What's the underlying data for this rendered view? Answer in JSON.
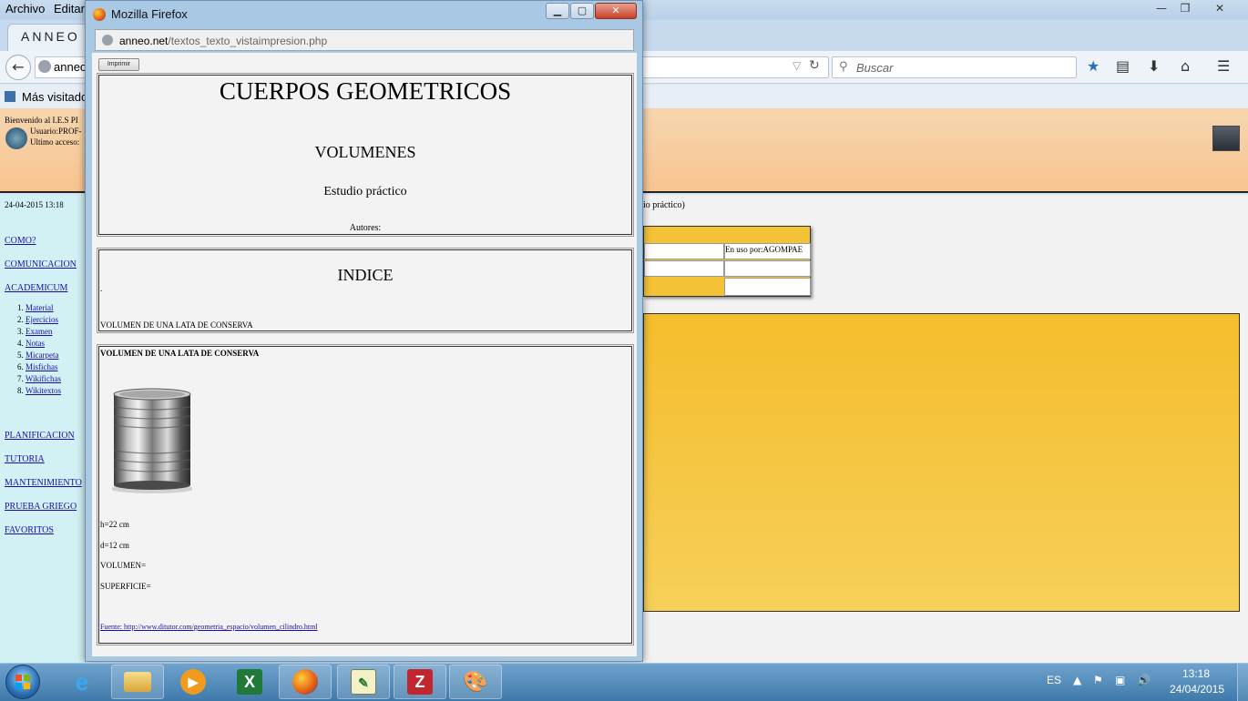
{
  "background_window": {
    "menu": [
      "Archivo",
      "Editar"
    ],
    "tab_title": "ANNEO",
    "url_text": "anneo",
    "search_placeholder": "Buscar",
    "bookmarks_label": "Más visitados",
    "page": {
      "welcome": "Bienvenido al I.E.S PI",
      "user": "Usuario:PROF-",
      "last_access": "Ultimo acceso:",
      "date": "24-04-2015 13:18",
      "nav": [
        "COMO?",
        "COMUNICACION",
        "ACADEMICUM"
      ],
      "subnav": [
        "Material",
        "Ejercicios",
        "Examen",
        "Notas",
        "Micarpeta",
        "Misfichas",
        "Wikifichas",
        "Wikitextos"
      ],
      "nav_bottom": [
        "PLANIFICACION",
        "TUTORIA",
        "MANTENIMIENTO",
        "PRUEBA GRIEGO",
        "FAVORITOS"
      ],
      "estudio_fragment": "io práctico)",
      "in_use": "En uso por:AGOMPAE"
    }
  },
  "popup": {
    "title": "Mozilla Firefox",
    "url_host": "anneo.net",
    "url_path": "/textos_texto_vistaimpresion.php",
    "print_button": "Imprimir",
    "doc": {
      "title": "CUERPOS GEOMETRICOS",
      "subtitle": "VOLUMENES",
      "estudio": "Estudio práctico",
      "autores": "Autores:",
      "indice_title": "INDICE",
      "indice_dot": ".",
      "indice_item": "VOLUMEN DE UNA LATA DE CONSERVA",
      "section_title": "VOLUMEN DE UNA LATA DE CONSERVA",
      "lines": [
        "h=22 cm",
        "d=12 cm",
        "VOLUMEN=",
        "SUPERFICIE="
      ],
      "source": "Fuente: http://www.ditutor.com/geometria_espacio/volumen_cilindro.html"
    }
  },
  "taskbar": {
    "language": "ES",
    "time": "13:18",
    "date": "24/04/2015",
    "apps": [
      "internet-explorer",
      "file-explorer",
      "media-player",
      "excel",
      "firefox",
      "notes",
      "filezilla",
      "paint"
    ]
  }
}
